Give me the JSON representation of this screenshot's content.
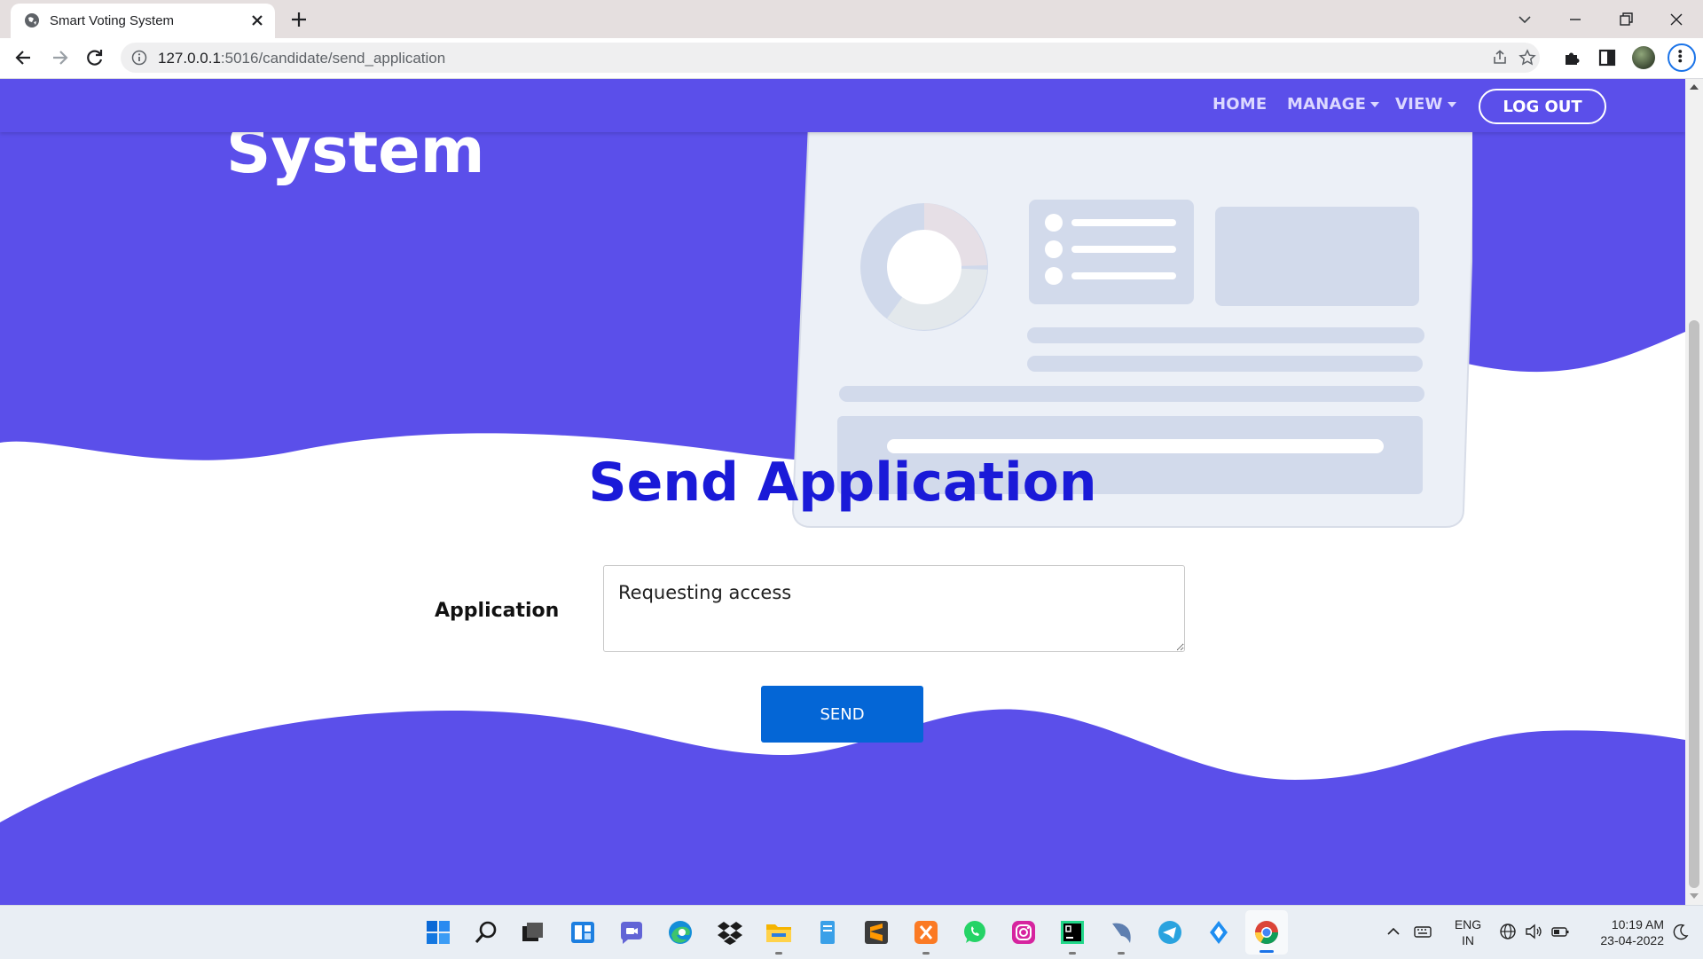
{
  "browser": {
    "tab_title": "Smart Voting System",
    "url_host": "127.0.0.1",
    "url_path": ":5016/candidate/send_application"
  },
  "navbar": {
    "items": [
      {
        "label": "HOME"
      },
      {
        "label": "MANAGE"
      },
      {
        "label": "VIEW"
      }
    ],
    "logout_label": "LOG OUT"
  },
  "hero": {
    "title_fragment": "System"
  },
  "form": {
    "title": "Send Application",
    "application_label": "Application",
    "application_value": "Requesting access",
    "send_label": "SEND"
  },
  "taskbar": {
    "lang_line1": "ENG",
    "lang_line2": "IN",
    "time": "10:19 AM",
    "date": "23-04-2022",
    "apps": [
      "start-icon",
      "search-icon",
      "task-view-icon",
      "widgets-icon",
      "teams-chat-icon",
      "edge-icon",
      "dropbox-icon",
      "file-explorer-icon",
      "notepad-icon",
      "sublime-text-icon",
      "xampp-icon",
      "whatsapp-icon",
      "instagram-icon",
      "pycharm-icon",
      "mysql-workbench-icon",
      "telegram-icon",
      "nearby-share-icon",
      "chrome-icon"
    ]
  },
  "colors": {
    "brand_purple": "#5b4fea",
    "title_blue": "#1a1ad8",
    "button_blue": "#0466d6"
  }
}
